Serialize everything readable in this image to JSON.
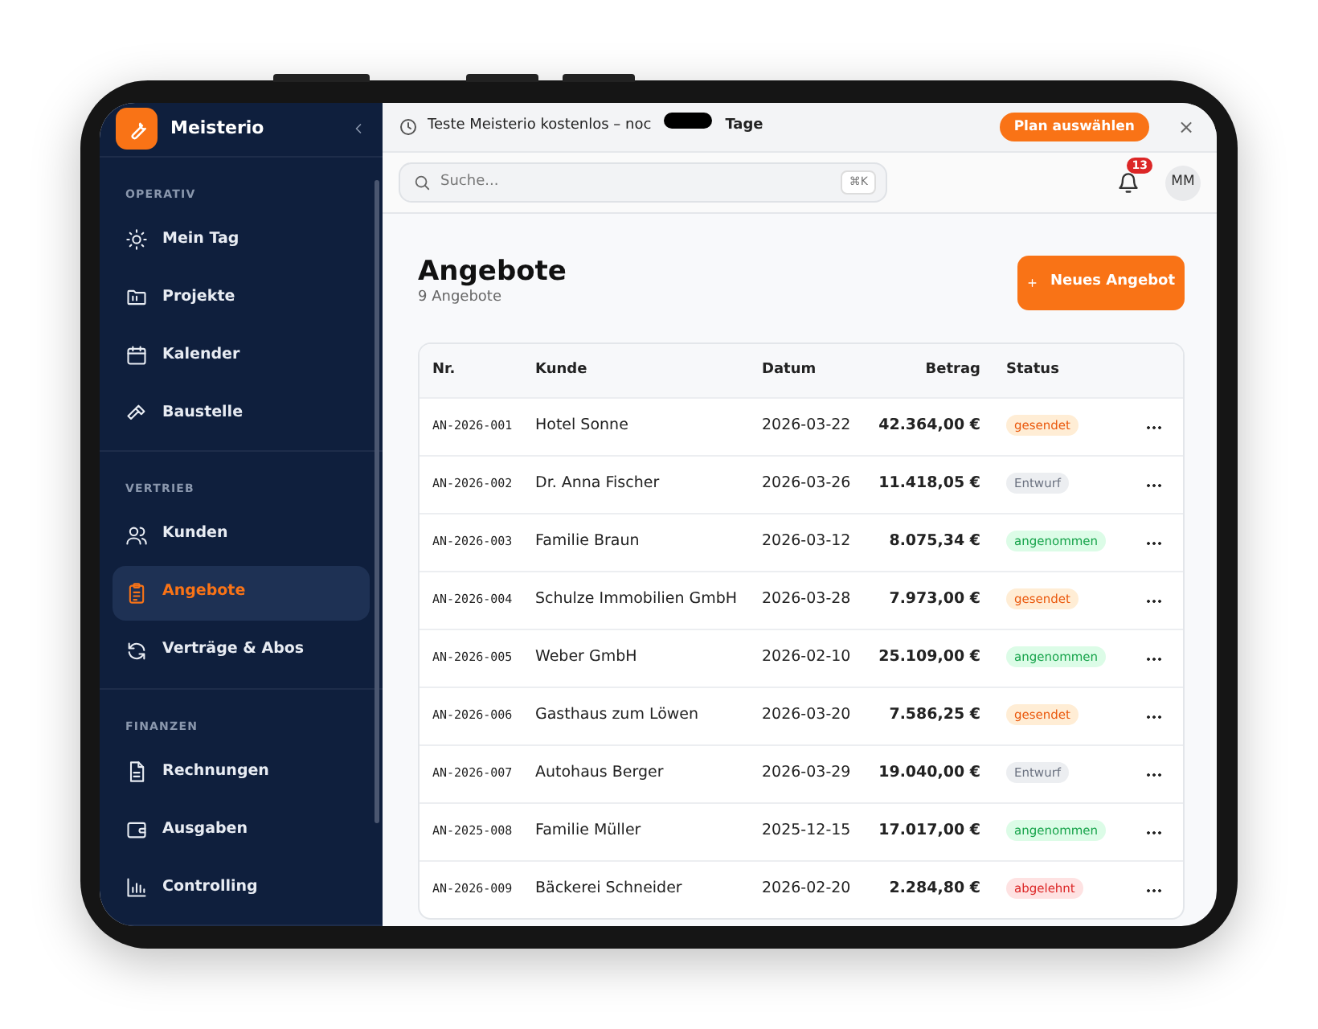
{
  "sidebar": {
    "brand": "Meisterio",
    "sections": [
      {
        "label": "OPERATIV",
        "items": [
          {
            "label": "Mein Tag",
            "selected": false
          },
          {
            "label": "Projekte",
            "selected": false
          },
          {
            "label": "Kalender",
            "selected": false
          },
          {
            "label": "Baustelle",
            "selected": false
          }
        ]
      },
      {
        "label": "VERTRIEB",
        "items": [
          {
            "label": "Kunden",
            "selected": false
          },
          {
            "label": "Angebote",
            "selected": true
          },
          {
            "label": "Verträge & Abos",
            "selected": false
          }
        ]
      },
      {
        "label": "FINANZEN",
        "items": [
          {
            "label": "Rechnungen",
            "selected": false
          },
          {
            "label": "Ausgaben",
            "selected": false
          },
          {
            "label": "Controlling",
            "selected": false
          }
        ]
      }
    ]
  },
  "banner": {
    "text": "Teste Meisterio kostenlos – noc",
    "emphasis": "Tage",
    "button": "Plan auswählen",
    "close": "×"
  },
  "topbar": {
    "search": {
      "placeholder": "Suche...",
      "shortcut": "⌘K"
    },
    "notifications": "13",
    "avatar": "MM"
  },
  "page": {
    "title": "Angebote",
    "subtitle": "9 Angebote",
    "new_button": "Neues Angebot"
  },
  "table": {
    "columns": [
      "Nr.",
      "Kunde",
      "Datum",
      "Betrag",
      "Status"
    ],
    "rows": [
      {
        "nr": "AN-2026-001",
        "kunde": "Hotel Sonne",
        "datum": "2026-03-22",
        "betrag": "42.364,00 €",
        "status": "gesendet",
        "kind": "sent"
      },
      {
        "nr": "AN-2026-002",
        "kunde": "Dr. Anna Fischer",
        "datum": "2026-03-26",
        "betrag": "11.418,05 €",
        "status": "Entwurf",
        "kind": "draft"
      },
      {
        "nr": "AN-2026-003",
        "kunde": "Familie Braun",
        "datum": "2026-03-12",
        "betrag": "8.075,34 €",
        "status": "angenommen",
        "kind": "accepted"
      },
      {
        "nr": "AN-2026-004",
        "kunde": "Schulze Immobilien GmbH",
        "datum": "2026-03-28",
        "betrag": "7.973,00 €",
        "status": "gesendet",
        "kind": "sent"
      },
      {
        "nr": "AN-2026-005",
        "kunde": "Weber GmbH",
        "datum": "2026-02-10",
        "betrag": "25.109,00 €",
        "status": "angenommen",
        "kind": "accepted"
      },
      {
        "nr": "AN-2026-006",
        "kunde": "Gasthaus zum Löwen",
        "datum": "2026-03-20",
        "betrag": "7.586,25 €",
        "status": "gesendet",
        "kind": "sent"
      },
      {
        "nr": "AN-2026-007",
        "kunde": "Autohaus Berger",
        "datum": "2026-03-29",
        "betrag": "19.040,00 €",
        "status": "Entwurf",
        "kind": "draft"
      },
      {
        "nr": "AN-2025-008",
        "kunde": "Familie Müller",
        "datum": "2025-12-15",
        "betrag": "17.017,00 €",
        "status": "angenommen",
        "kind": "accepted"
      },
      {
        "nr": "AN-2026-009",
        "kunde": "Bäckerei Schneider",
        "datum": "2026-02-20",
        "betrag": "2.284,80 €",
        "status": "abgelehnt",
        "kind": "rejected"
      }
    ]
  }
}
